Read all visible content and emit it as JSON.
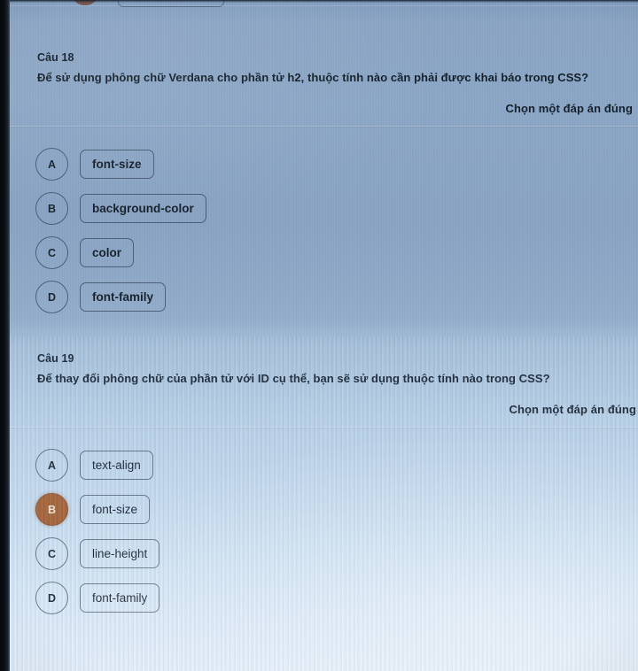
{
  "questions": [
    {
      "label": "Câu 18",
      "text": "Để sử dụng phông chữ Verdana cho phần tử h2, thuộc tính nào cần phải được khai báo trong CSS?",
      "hint": "Chọn một đáp án đúng",
      "options": [
        {
          "key": "A",
          "text": "font-size",
          "selected": false
        },
        {
          "key": "B",
          "text": "background-color",
          "selected": false
        },
        {
          "key": "C",
          "text": "color",
          "selected": false
        },
        {
          "key": "D",
          "text": "font-family",
          "selected": false
        }
      ]
    },
    {
      "label": "Câu 19",
      "text": "Để thay đổi phông chữ của phần tử với ID cụ thể, bạn sẽ sử dụng thuộc tính nào trong CSS?",
      "hint": "Chọn một đáp án đúng",
      "options": [
        {
          "key": "A",
          "text": "text-align",
          "selected": false
        },
        {
          "key": "B",
          "text": "font-size",
          "selected": true
        },
        {
          "key": "C",
          "text": "line-height",
          "selected": false
        },
        {
          "key": "D",
          "text": "font-family",
          "selected": false
        }
      ]
    }
  ],
  "colors": {
    "selected_option": "#a35f31",
    "screen_top": "#8aa4c4",
    "screen_bottom": "#e4effa",
    "text": "#15212d"
  }
}
